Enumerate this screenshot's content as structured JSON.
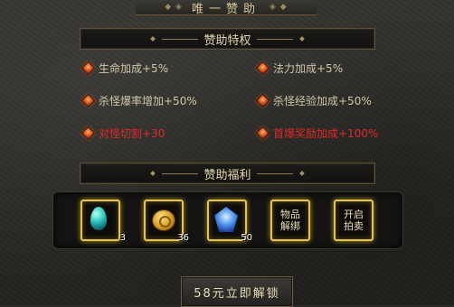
{
  "title": "唯一赞助",
  "privileges": {
    "header": "赞助特权",
    "items": [
      {
        "text": "生命加成+5%",
        "color": "normal"
      },
      {
        "text": "法力加成+5%",
        "color": "normal"
      },
      {
        "text": "杀怪爆率增加+50%",
        "color": "normal"
      },
      {
        "text": "杀怪经验加成+50%",
        "color": "normal"
      },
      {
        "text": "对怪切割+30",
        "color": "red"
      },
      {
        "text": "首爆奖励加成+100%",
        "color": "red"
      }
    ]
  },
  "benefits": {
    "header": "赞助福利",
    "items": [
      {
        "icon": "blue-egg-icon",
        "count": "3"
      },
      {
        "icon": "gold-coin-icon",
        "count": "36"
      },
      {
        "icon": "blue-crystal-icon",
        "count": "50"
      },
      {
        "label": "物品解绑"
      },
      {
        "label": "开启拍卖"
      }
    ]
  },
  "buy_button": "58元立即解锁",
  "colors": {
    "gold_border": "#e6c44a",
    "red_text": "#e0282a",
    "text": "#d2c6a8"
  }
}
